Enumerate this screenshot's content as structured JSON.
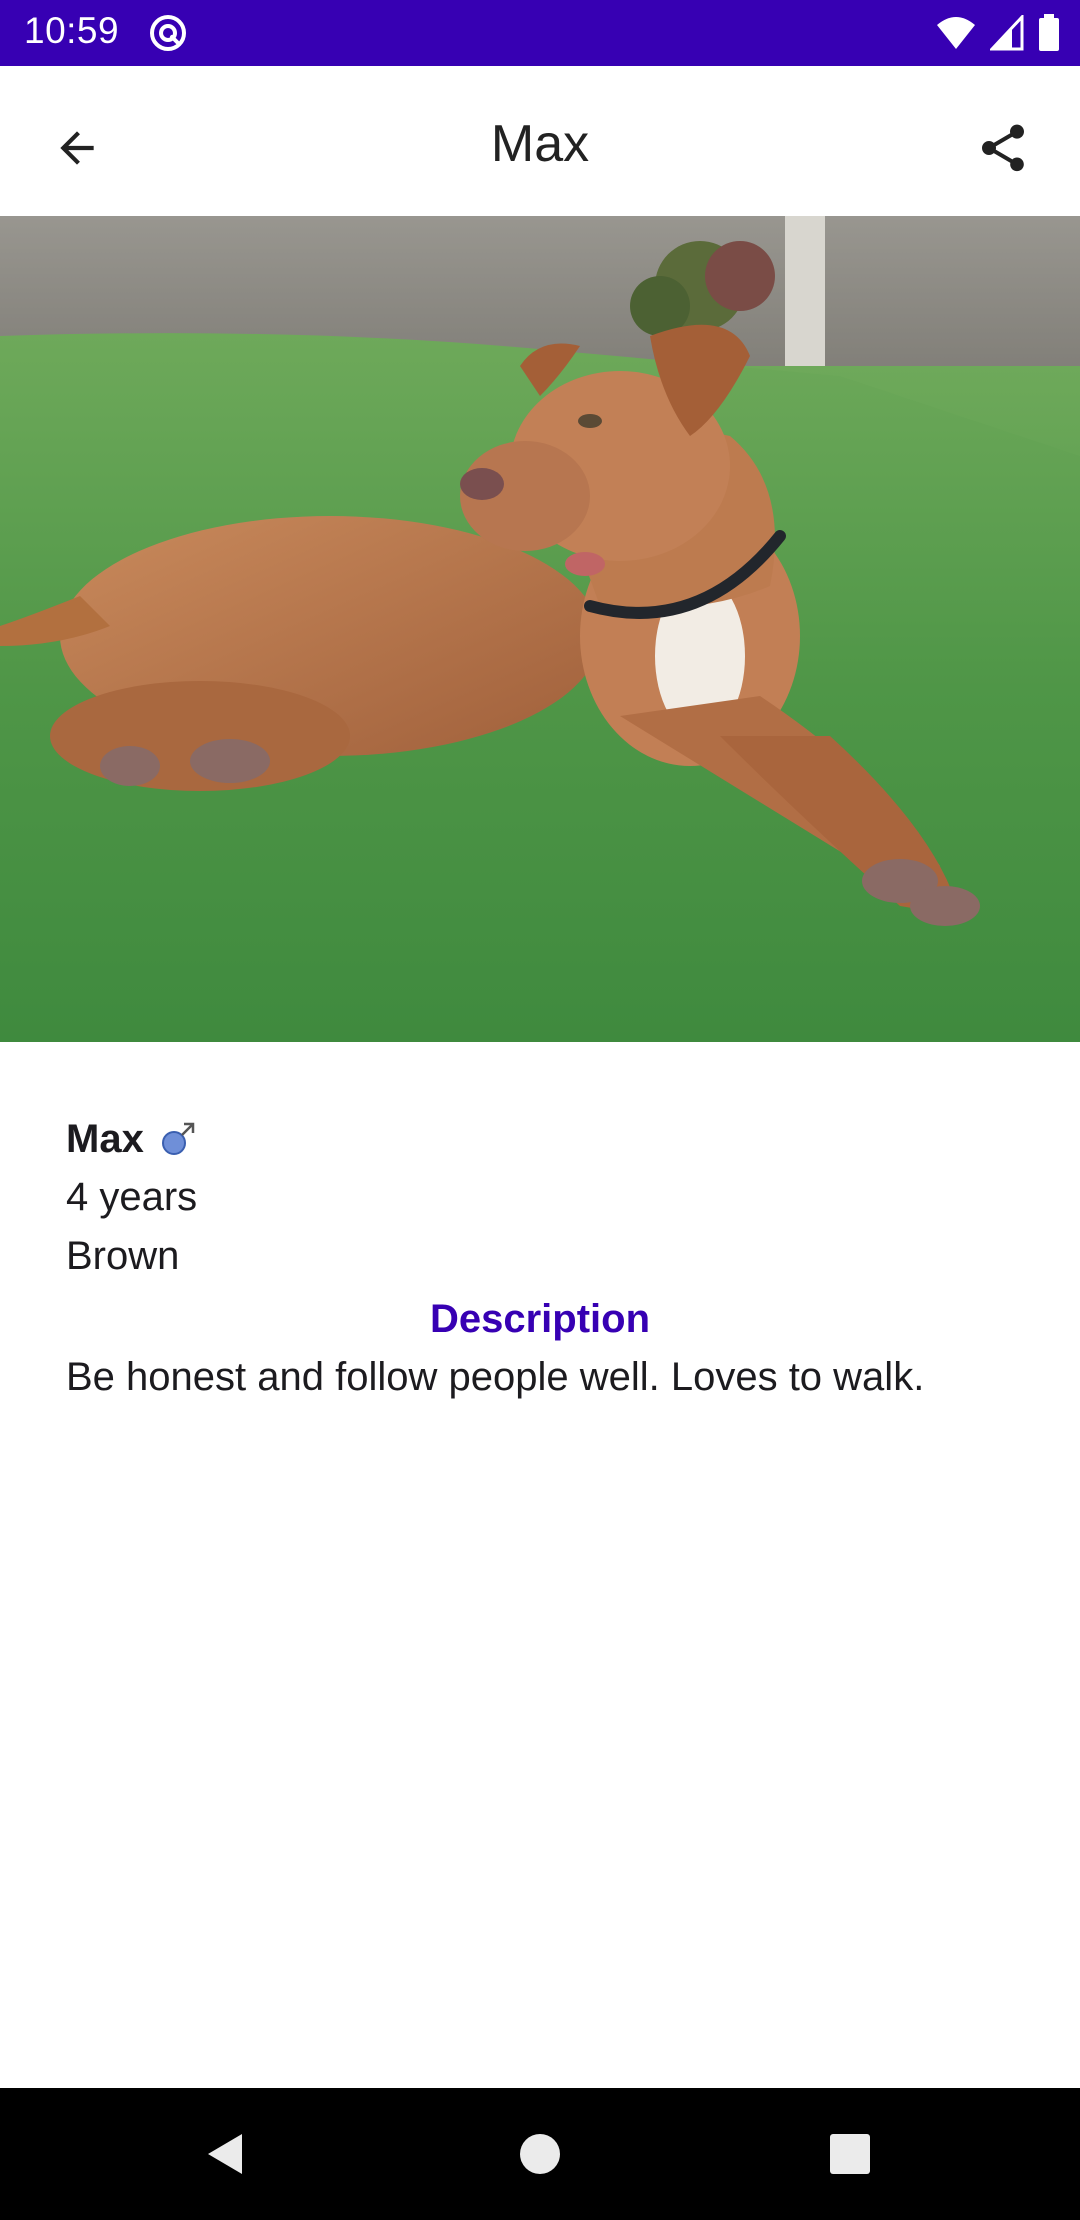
{
  "status_bar": {
    "time": "10:59",
    "background": "#3700b3"
  },
  "app_bar": {
    "title": "Max",
    "back_icon": "arrow-back-icon",
    "share_icon": "share-icon"
  },
  "photo": {
    "subject": "dog-photo"
  },
  "pet": {
    "name": "Max",
    "gender_icon": "male-icon",
    "age": "4 years",
    "color": "Brown"
  },
  "description": {
    "title": "Description",
    "text": "Be honest and follow people well. Loves to walk."
  },
  "colors": {
    "primary": "#3700b3",
    "text": "#1c1b1f",
    "gender_icon": "#6f8fd8"
  }
}
